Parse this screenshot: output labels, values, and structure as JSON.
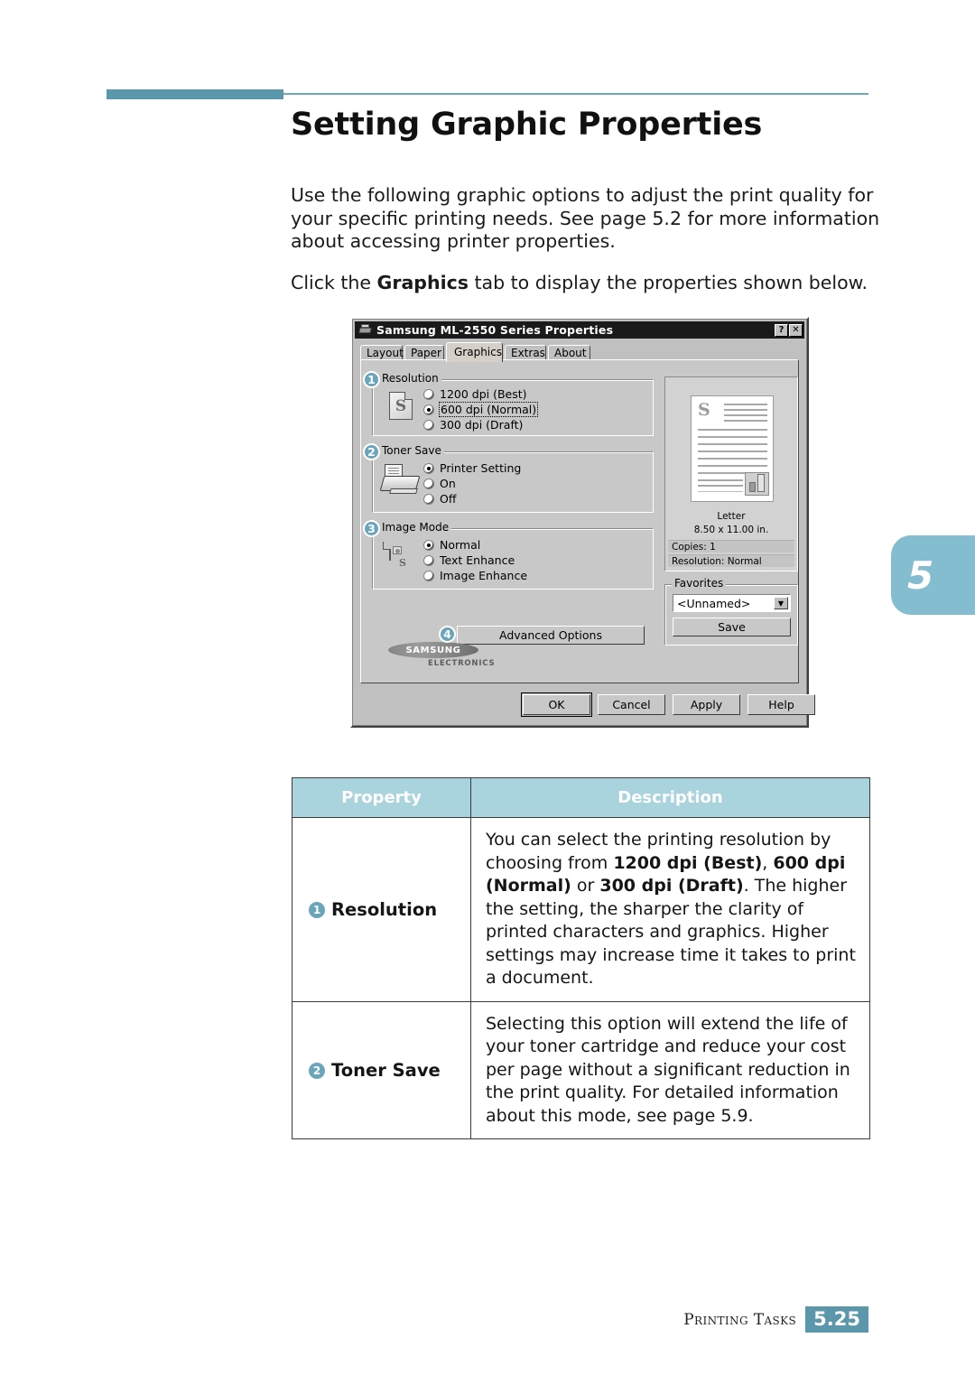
{
  "header": {
    "title": "Setting Graphic Properties"
  },
  "body": {
    "paragraph1": "Use the following graphic options to adjust the print quality for your specific printing needs. See page 5.2 for more information about accessing printer properties.",
    "paragraph2_pre": "Click the ",
    "paragraph2_bold": "Graphics",
    "paragraph2_post": " tab to display the properties shown below."
  },
  "chapter_tab": {
    "number": "5"
  },
  "dialog": {
    "title": "Samsung ML-2550 Series Properties",
    "titlebar_buttons": {
      "help": "?",
      "close": "✕"
    },
    "tabs": [
      {
        "label": "Layout",
        "selected": false
      },
      {
        "label": "Paper",
        "selected": false
      },
      {
        "label": "Graphics",
        "selected": true
      },
      {
        "label": "Extras",
        "selected": false
      },
      {
        "label": "About",
        "selected": false
      }
    ],
    "groups": [
      {
        "number": "1",
        "label": "Resolution",
        "options": [
          {
            "label": "1200 dpi (Best)",
            "selected": false
          },
          {
            "label": "600 dpi (Normal)",
            "selected": true,
            "focused": true
          },
          {
            "label": "300 dpi (Draft)",
            "selected": false
          }
        ]
      },
      {
        "number": "2",
        "label": "Toner Save",
        "options": [
          {
            "label": "Printer Setting",
            "selected": true
          },
          {
            "label": "On",
            "selected": false
          },
          {
            "label": "Off",
            "selected": false
          }
        ]
      },
      {
        "number": "3",
        "label": "Image Mode",
        "options": [
          {
            "label": "Normal",
            "selected": true
          },
          {
            "label": "Text Enhance",
            "selected": false
          },
          {
            "label": "Image Enhance",
            "selected": false
          }
        ]
      }
    ],
    "advanced_options": {
      "number": "4",
      "label": "Advanced Options"
    },
    "preview": {
      "paper_name": "Letter",
      "paper_size": "8.50 x 11.00 in.",
      "copies": "Copies: 1",
      "resolution": "Resolution: Normal",
      "page_letter": "S"
    },
    "favorites": {
      "label": "Favorites",
      "selected_value": "<Unnamed>",
      "dropdown_arrow": "▼",
      "save_label": "Save"
    },
    "brand": {
      "name": "SAMSUNG",
      "sub": "ELECTRONICS"
    },
    "buttons": [
      {
        "label": "OK",
        "default": true
      },
      {
        "label": "Cancel",
        "default": false
      },
      {
        "label": "Apply",
        "default": false,
        "underline_index": 0
      },
      {
        "label": "Help",
        "default": false
      }
    ]
  },
  "table": {
    "headers": [
      "Property",
      "Description"
    ],
    "rows": [
      {
        "badge": "1",
        "property": "Resolution",
        "description_html": "You can select the printing resolution by choosing from <b>1200 dpi (Best)</b>, <b>600 dpi (Normal)</b> or <b>300 dpi (Draft)</b>. The higher the setting, the sharper the clarity of printed characters and graphics. Higher settings may increase time it takes to print a document."
      },
      {
        "badge": "2",
        "property": "Toner Save",
        "description_html": "Selecting this option will extend the life of your toner cartridge and reduce your cost per page without a significant reduction in the print quality. For detailed information about this mode, see page 5.9."
      }
    ]
  },
  "footer": {
    "text": "Printing Tasks",
    "page_number": "5.25"
  },
  "colors": {
    "accent_rule": "#5b97ab",
    "table_header": "#a9d3dd",
    "badge": "#6aa5bc",
    "chapter_tab": "#85bdd0",
    "dialog_face": "#c8c8c8",
    "titlebar": "#1a1a1a"
  }
}
